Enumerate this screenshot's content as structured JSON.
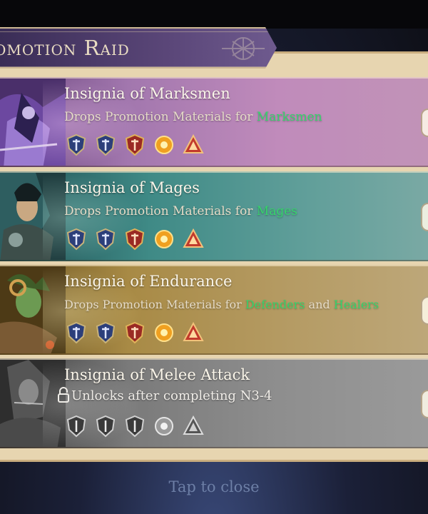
{
  "raid": {
    "title": "omotion Raid"
  },
  "cards": [
    {
      "title": "Insignia of Marksmen",
      "desc_prefix": "Drops Promotion Materials for ",
      "class_1": "Marksmen",
      "locked": false,
      "accent": "#8a5a9a",
      "materials": [
        "blue-shield-insignia-icon",
        "blue-shield-insignia-icon",
        "red-shield-insignia-icon",
        "gold-orb-icon",
        "red-triangle-badge-icon"
      ]
    },
    {
      "title": "Insignia of Mages",
      "desc_prefix": "Drops Promotion Materials for ",
      "class_1": "Mages",
      "locked": false,
      "accent": "#3f8a86",
      "materials": [
        "blue-shield-insignia-icon",
        "blue-shield-insignia-icon",
        "red-shield-insignia-icon",
        "gold-orb-icon",
        "red-triangle-badge-icon"
      ]
    },
    {
      "title": "Insignia of Endurance",
      "desc_prefix": "Drops Promotion Materials for ",
      "class_1": "Defenders",
      "joiner": " and ",
      "class_2": "Healers",
      "locked": false,
      "accent": "#9a8046",
      "materials": [
        "blue-shield-insignia-icon",
        "blue-shield-insignia-icon",
        "red-shield-insignia-icon",
        "gold-orb-icon",
        "red-triangle-badge-icon"
      ]
    },
    {
      "title": "Insignia of Melee Attack",
      "lock_text": "Unlocks after completing N3-4",
      "locked": true,
      "accent": "#8a8a8a",
      "materials": [
        "grey-shield-insignia-icon",
        "grey-shield-insignia-icon",
        "grey-shield-insignia-icon",
        "grey-orb-icon",
        "grey-triangle-badge-icon"
      ]
    }
  ],
  "footer": {
    "close_label": "Tap to close"
  },
  "colors": {
    "highlight_green": "#36d46c",
    "panel_cream": "#e7d5b0",
    "banner_purple": "#5a4678"
  }
}
